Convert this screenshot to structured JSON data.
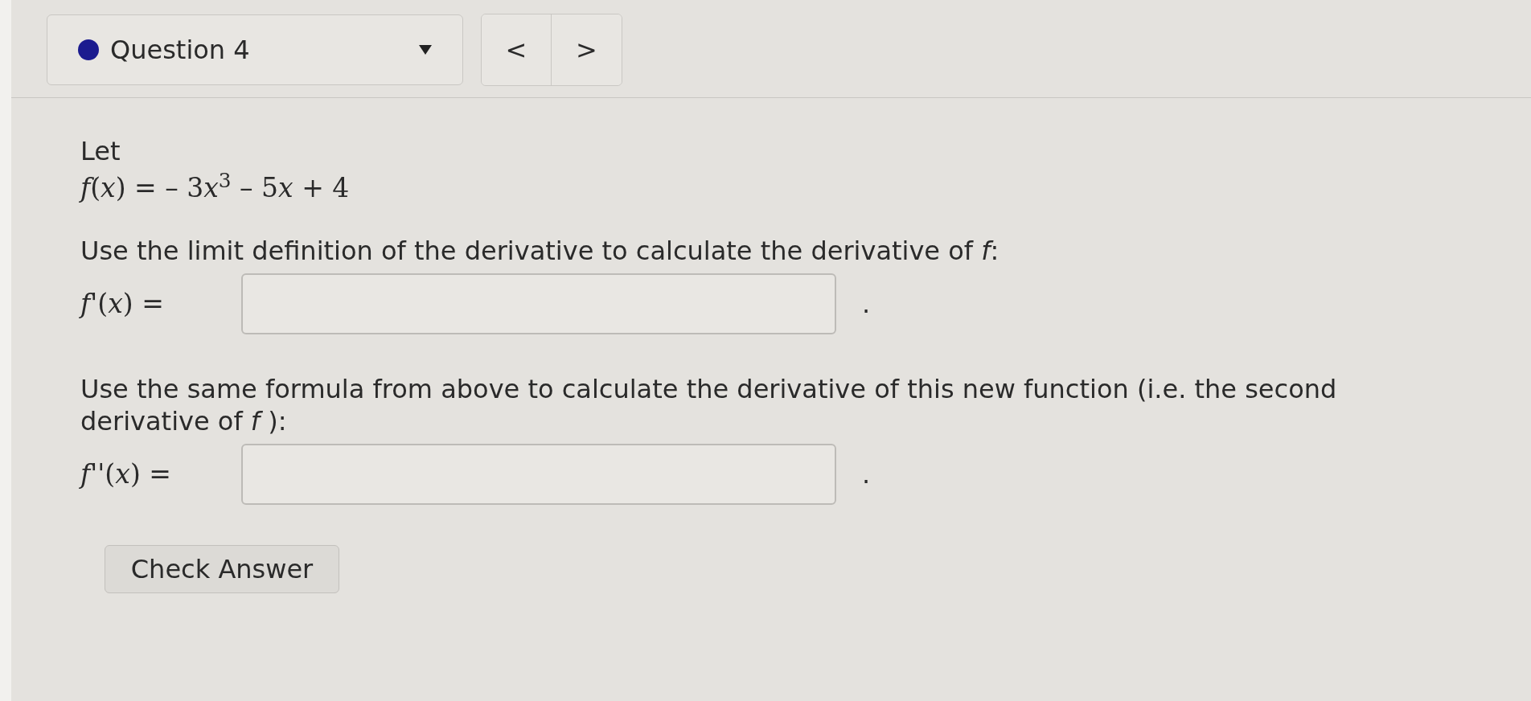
{
  "question_selector": {
    "label": "Question 4"
  },
  "nav": {
    "previous": "<",
    "next": ">"
  },
  "intro": "Let",
  "function": [
    "*f*(*x*) = ",
    "– 3",
    "*x*$^{3}$",
    " – 5",
    "*x*",
    " + 4"
  ],
  "answers": [
    {
      "prompt": "Use the limit definition of the derivative to calculate the derivative of *f*:",
      "label": "*f*'(*x*) =",
      "after": "."
    },
    {
      "prompt": "Use the same formula from above to calculate the derivative of this new function (i.e. the second derivative of *f* ):",
      "label": "*f*''(*x*) =",
      "after": "."
    }
  ],
  "check_button": "Check Answer"
}
